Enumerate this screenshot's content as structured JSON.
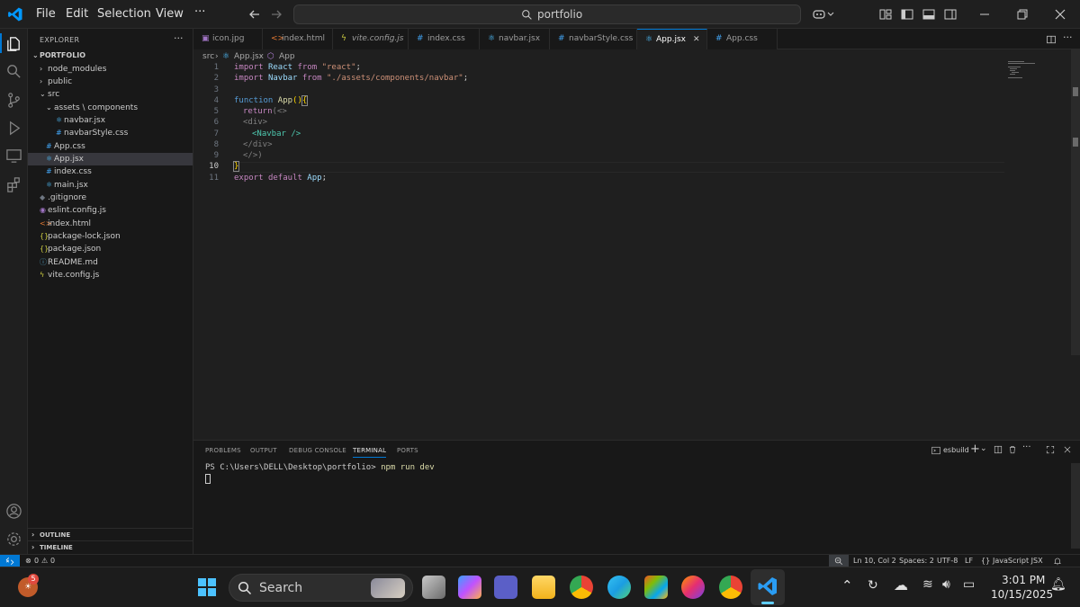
{
  "menu": {
    "file": "File",
    "edit": "Edit",
    "selection": "Selection",
    "view": "View",
    "more": "···"
  },
  "search": {
    "text": "portfolio"
  },
  "sidebar": {
    "title": "EXPLORER",
    "more": "···",
    "root": "PORTFOLIO",
    "items": [
      {
        "label": "node_modules",
        "icon": "›",
        "color": "#cccccc"
      },
      {
        "label": "public",
        "icon": "›",
        "color": "#cccccc"
      },
      {
        "label": "src",
        "icon": "⌄",
        "color": "#cccccc"
      },
      {
        "label": "assets \\ components",
        "icon": "⌄",
        "color": "#cccccc"
      },
      {
        "label": "navbar.jsx",
        "icon": "⚛",
        "color": "#4fc1ff"
      },
      {
        "label": "navbarStyle.css",
        "icon": "#",
        "color": "#42a5f5"
      },
      {
        "label": "App.css",
        "icon": "#",
        "color": "#42a5f5"
      },
      {
        "label": "App.jsx",
        "icon": "⚛",
        "color": "#4fc1ff"
      },
      {
        "label": "index.css",
        "icon": "#",
        "color": "#42a5f5"
      },
      {
        "label": "main.jsx",
        "icon": "⚛",
        "color": "#4fc1ff"
      },
      {
        "label": ".gitignore",
        "icon": "◆",
        "color": "#6e7681"
      },
      {
        "label": "eslint.config.js",
        "icon": "◉",
        "color": "#a074c4"
      },
      {
        "label": "index.html",
        "icon": "<>",
        "color": "#e37933"
      },
      {
        "label": "package-lock.json",
        "icon": "{}",
        "color": "#cbcb41"
      },
      {
        "label": "package.json",
        "icon": "{}",
        "color": "#cbcb41"
      },
      {
        "label": "README.md",
        "icon": "ⓘ",
        "color": "#519aba"
      },
      {
        "label": "vite.config.js",
        "icon": "ϟ",
        "color": "#cbcb41"
      }
    ],
    "outline": "OUTLINE",
    "timeline": "TIMELINE"
  },
  "tabs": [
    {
      "label": "icon.jpg",
      "icon": "▣",
      "color": "#a074c4"
    },
    {
      "label": "index.html",
      "icon": "<>",
      "color": "#e37933"
    },
    {
      "label": "vite.config.js",
      "icon": "ϟ",
      "color": "#cbcb41"
    },
    {
      "label": "index.css",
      "icon": "#",
      "color": "#42a5f5"
    },
    {
      "label": "navbar.jsx",
      "icon": "⚛",
      "color": "#4fc1ff"
    },
    {
      "label": "navbarStyle.css",
      "icon": "#",
      "color": "#42a5f5"
    },
    {
      "label": "App.jsx",
      "icon": "⚛",
      "color": "#4fc1ff",
      "active": true
    },
    {
      "label": "App.css",
      "icon": "#",
      "color": "#42a5f5"
    }
  ],
  "breadcrumb": {
    "folder": "src",
    "file": "App.jsx",
    "symbol": "App"
  },
  "editor": {
    "line_numbers": [
      "1",
      "2",
      "3",
      "4",
      "5",
      "6",
      "7",
      "8",
      "9",
      "10",
      "11"
    ],
    "line1": {
      "kw": "import",
      "id": "React",
      "from": "from",
      "str": "\"react\"",
      "end": ";"
    },
    "line2": {
      "kw": "import",
      "id": "Navbar",
      "from": "from",
      "str": "\"./assets/components/navbar\"",
      "end": ";"
    },
    "line4": {
      "kb": "function",
      "fn": "App",
      "p": "()",
      "b": "{"
    },
    "line5": {
      "kw": "return",
      "p": "(<>"
    },
    "line6": {
      "t": "<div>"
    },
    "line7": {
      "t": "<Navbar />"
    },
    "line8": {
      "t": "</div>"
    },
    "line9": {
      "t": "</>)"
    },
    "line10": {
      "t": "}"
    },
    "line11": {
      "kw": "export",
      "kw2": "default",
      "id": "App",
      "end": ";"
    }
  },
  "panel": {
    "tabs": [
      "PROBLEMS",
      "OUTPUT",
      "DEBUG CONSOLE",
      "TERMINAL",
      "PORTS"
    ],
    "active_tab": "TERMINAL",
    "terminal_name": "esbuild",
    "prompt": "PS C:\\Users\\DELL\\Desktop\\portfolio>",
    "command": "npm run dev"
  },
  "status": {
    "errors": "0",
    "warnings": "0",
    "position": "Ln 10, Col 2",
    "spaces": "Spaces: 2",
    "encoding": "UTF-8",
    "eol": "LF",
    "language": "JavaScript JSX"
  },
  "taskbar": {
    "search": "Search",
    "time": "3:01 PM",
    "date": "10/15/2025",
    "badge": "5"
  }
}
